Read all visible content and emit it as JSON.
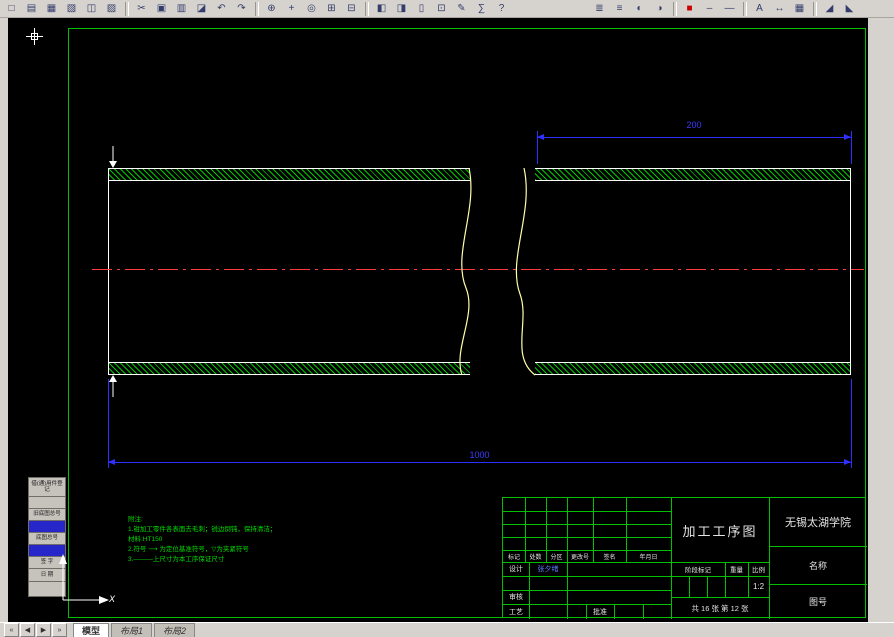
{
  "window": {
    "bg": "#d6d3ce",
    "canvas_bg": "#000000"
  },
  "toolbar": {
    "icons": [
      {
        "name": "new-file",
        "glyph": "□"
      },
      {
        "name": "open-file",
        "glyph": "▤"
      },
      {
        "name": "save",
        "glyph": "▦"
      },
      {
        "name": "plot",
        "glyph": "▧"
      },
      {
        "name": "plot-preview",
        "glyph": "◫"
      },
      {
        "name": "publish",
        "glyph": "▨"
      },
      {
        "type": "sep"
      },
      {
        "name": "cut",
        "glyph": "✂"
      },
      {
        "name": "copy",
        "glyph": "▣"
      },
      {
        "name": "paste",
        "glyph": "▥"
      },
      {
        "name": "match-properties",
        "glyph": "◪"
      },
      {
        "name": "undo",
        "glyph": "↶"
      },
      {
        "name": "redo",
        "glyph": "↷"
      },
      {
        "type": "sep"
      },
      {
        "name": "insert-hyperlink",
        "glyph": "⊕"
      },
      {
        "name": "pan-realtime",
        "glyph": "+"
      },
      {
        "name": "zoom-realtime",
        "glyph": "◎"
      },
      {
        "name": "zoom-window",
        "glyph": "⊞"
      },
      {
        "name": "zoom-previous",
        "glyph": "⊟"
      },
      {
        "type": "sep"
      },
      {
        "name": "properties",
        "glyph": "◧"
      },
      {
        "name": "designcenter",
        "glyph": "◨"
      },
      {
        "name": "tool-palettes",
        "glyph": "▯"
      },
      {
        "name": "sheet-set-manager",
        "glyph": "⊡"
      },
      {
        "name": "markup-set-manager",
        "glyph": "✎"
      },
      {
        "name": "quick-calc",
        "glyph": "∑"
      },
      {
        "name": "help",
        "glyph": "?"
      },
      {
        "type": "gap"
      },
      {
        "name": "layer-properties",
        "glyph": "≣"
      },
      {
        "name": "layer-states",
        "glyph": "≡"
      },
      {
        "name": "make-object-layer",
        "glyph": "◐"
      },
      {
        "name": "layer-previous",
        "glyph": "◑"
      },
      {
        "type": "sep"
      },
      {
        "name": "color-control",
        "glyph": "■",
        "color": "#cc0000"
      },
      {
        "name": "linetype-control",
        "glyph": "‒"
      },
      {
        "name": "lineweight-control",
        "glyph": "—"
      },
      {
        "type": "sep"
      },
      {
        "name": "text-style",
        "glyph": "A"
      },
      {
        "name": "dimension-style",
        "glyph": "↔"
      },
      {
        "name": "table-style",
        "glyph": "▦"
      },
      {
        "type": "sep"
      },
      {
        "name": "corner-grip-left",
        "glyph": "◢"
      },
      {
        "name": "corner-grip-right",
        "glyph": "◣"
      }
    ]
  },
  "drawing": {
    "dimensions": {
      "top": "200",
      "overall": "1000"
    },
    "notes": [
      "附注:",
      "1.钳加工零件各表面去毛刺；锐边倒钝，保持清洁；",
      "材料:HT150",
      "2.符号 ⟶ 为定位基准符号，▽为夹紧符号",
      "3.———上尺寸为本工序保证尺寸"
    ],
    "colors": {
      "frame": "#00c000",
      "outline": "#ffffff",
      "hatch": "#00c000",
      "centerline": "#ff3333",
      "dimension": "#2f2fff",
      "break_line": "#ffffa8",
      "notes": "#00dd00"
    }
  },
  "title_block": {
    "title": "加工工序图",
    "institution": "无锡太湖学院",
    "name_label": "名称",
    "drawing_number_label": "图号",
    "change_headers": [
      "标记",
      "处数",
      "分区",
      "更改号",
      "签名",
      "年月日"
    ],
    "design_label": "设计",
    "designer_name": "张夕绪",
    "check_label": "审核",
    "process_label": "工艺",
    "approve_label": "批准",
    "stage_label": "阶段标记",
    "weight_label": "重量",
    "scale_label": "比例",
    "scale_value": "1:2",
    "sheet_info": "共 16 张 第 12 张"
  },
  "left_margin": {
    "rows": [
      {
        "label": "借(通)用件登记",
        "h": 20,
        "blue": false
      },
      {
        "label": "",
        "h": 13,
        "blue": false
      },
      {
        "label": "旧底图总号",
        "h": 13,
        "blue": false
      },
      {
        "label": "",
        "h": 13,
        "blue": true
      },
      {
        "label": "底图总号",
        "h": 13,
        "blue": false
      },
      {
        "label": "",
        "h": 13,
        "blue": true
      },
      {
        "label": "签 字",
        "h": 13,
        "blue": false
      },
      {
        "label": "日 期",
        "h": 14,
        "blue": false
      },
      {
        "label": "",
        "h": 16,
        "blue": false
      }
    ]
  },
  "ucs": {
    "x_label": "X"
  },
  "tabs": {
    "active": 0,
    "nav": [
      "«",
      "◀",
      "▶",
      "»"
    ],
    "items": [
      "模型",
      "布局1",
      "布局2"
    ]
  }
}
